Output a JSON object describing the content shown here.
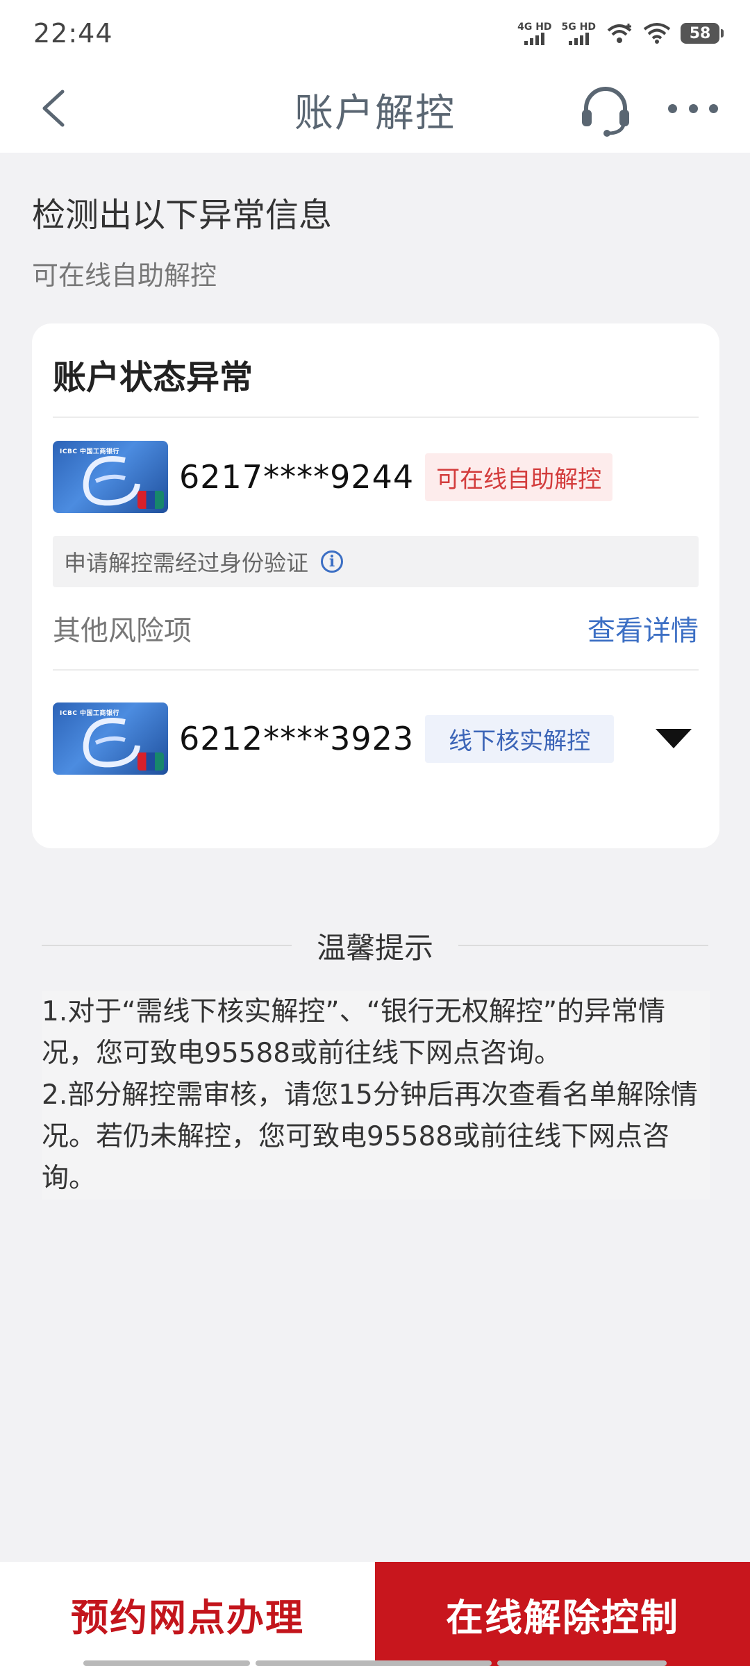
{
  "status_bar": {
    "time": "22:44",
    "net1": "4G HD",
    "net2": "5G HD",
    "battery": "58"
  },
  "nav": {
    "title": "账户解控",
    "back_icon": "chevron-left-icon",
    "support_icon": "headset-icon",
    "more_icon": "more-dots-icon"
  },
  "intro": {
    "title": "检测出以下异常信息",
    "subtitle": "可在线自助解控"
  },
  "card": {
    "title": "账户状态异常",
    "primary_account": {
      "card_brand": "ICBC 中国工商银行",
      "number": "6217****9244",
      "tag": "可在线自助解控"
    },
    "verify_note": "申请解控需经过身份验证",
    "info_symbol": "i",
    "other_risks": {
      "label": "其他风险项",
      "link": "查看详情"
    },
    "secondary_account": {
      "card_brand": "ICBC 中国工商银行",
      "number": "6212****3923",
      "tag": "线下核实解控"
    }
  },
  "tips": {
    "title": "温馨提示",
    "item1": "1.对于“需线下核实解控”、“银行无权解控”的异常情况，您可致电95588或前往线下网点咨询。",
    "item2": "2.部分解控需审核，请您15分钟后再次查看名单解除情况。若仍未解控，您可致电95588或前往线下网点咨询。"
  },
  "actions": {
    "branch_button": "预约网点办理",
    "online_button": "在线解除控制"
  },
  "colors": {
    "accent_red": "#c8161d",
    "link_blue": "#3c6fc4",
    "tag_red": "#d33c3c",
    "tag_blue": "#3b64b7"
  }
}
